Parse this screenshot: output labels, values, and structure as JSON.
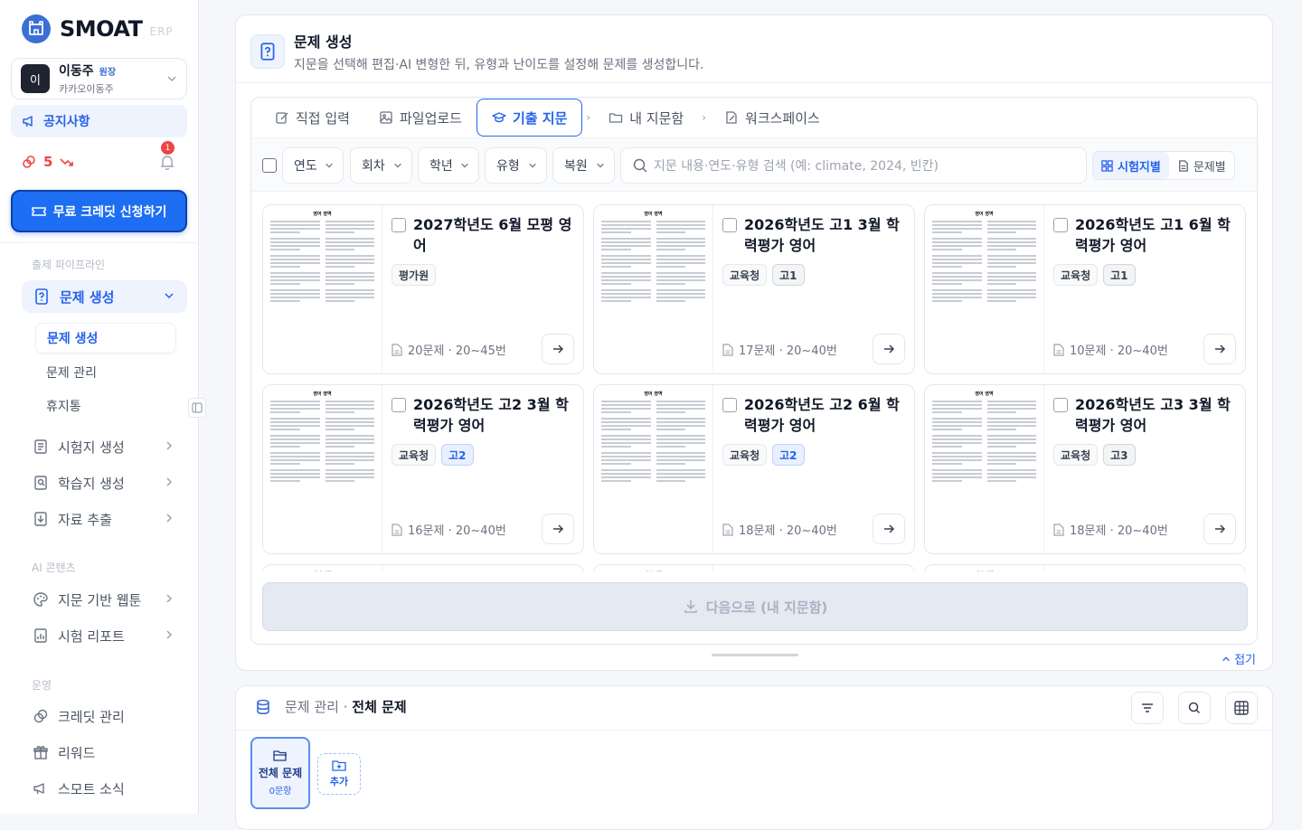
{
  "brand": {
    "name": "SMOAT",
    "sub": "ERP"
  },
  "user": {
    "avatar": "이",
    "name": "이동주",
    "role": "원장",
    "academy": "카카오이동주"
  },
  "sidebar": {
    "notice": "공지사항",
    "credits": "5",
    "notif_count": "1",
    "free_credit_btn": "무료 크레딧 신청하기",
    "sec_pipeline": "출제 파이프라인",
    "nav_generate": "문제 생성",
    "sub_items": [
      "문제 생성",
      "문제 관리",
      "휴지통"
    ],
    "nav_exam": "시험지 생성",
    "nav_worksheet": "학습지 생성",
    "nav_extract": "자료 추출",
    "sec_ai": "AI 콘텐츠",
    "nav_webtoon": "지문 기반 웹툰",
    "nav_report": "시험 리포트",
    "sec_ops": "운영",
    "nav_credit": "크레딧 관리",
    "nav_reward": "리워드",
    "nav_news": "스모트 소식"
  },
  "generate": {
    "title": "문제 생성",
    "subtitle": "지문을 선택해 편집·AI 변형한 뒤, 유형과 난이도를 설정해 문제를 생성합니다.",
    "tabs": [
      "직접 입력",
      "파일업로드",
      "기출 지문",
      "내 지문함",
      "워크스페이스"
    ],
    "filters": [
      "연도",
      "회차",
      "학년",
      "유형",
      "복원"
    ],
    "search_placeholder": "지문 내용·연도·유형 검색 (예: climate, 2024, 빈칸)",
    "view_by_exam": "시험지별",
    "view_by_question": "문제별",
    "thumb_header": "영어 영역",
    "cards": [
      {
        "title": "2027학년도 6월 모평 영어",
        "tags": [
          "평가원"
        ],
        "meta": "20문제 · 20~45번"
      },
      {
        "title": "2026학년도 고1 3월 학력평가 영어",
        "tags": [
          "교육청",
          "고1"
        ],
        "meta": "17문제 · 20~40번"
      },
      {
        "title": "2026학년도 고1 6월 학력평가 영어",
        "tags": [
          "교육청",
          "고1"
        ],
        "meta": "10문제 · 20~40번"
      },
      {
        "title": "2026학년도 고2 3월 학력평가 영어",
        "tags": [
          "교육청",
          "고2"
        ],
        "meta": "16문제 · 20~40번"
      },
      {
        "title": "2026학년도 고2 6월 학력평가 영어",
        "tags": [
          "교육청",
          "고2"
        ],
        "meta": "18문제 · 20~40번"
      },
      {
        "title": "2026학년도 고3 3월 학력평가 영어",
        "tags": [
          "교육청",
          "고3"
        ],
        "meta": "18문제 · 20~40번"
      }
    ],
    "next_btn": "다음으로 (내 지문함)",
    "fold": "접기"
  },
  "manage": {
    "crumb": "문제 관리 ·",
    "current": "전체 문제",
    "folder_all": "전체 문제",
    "folder_count": "0문항",
    "add": "추가"
  }
}
